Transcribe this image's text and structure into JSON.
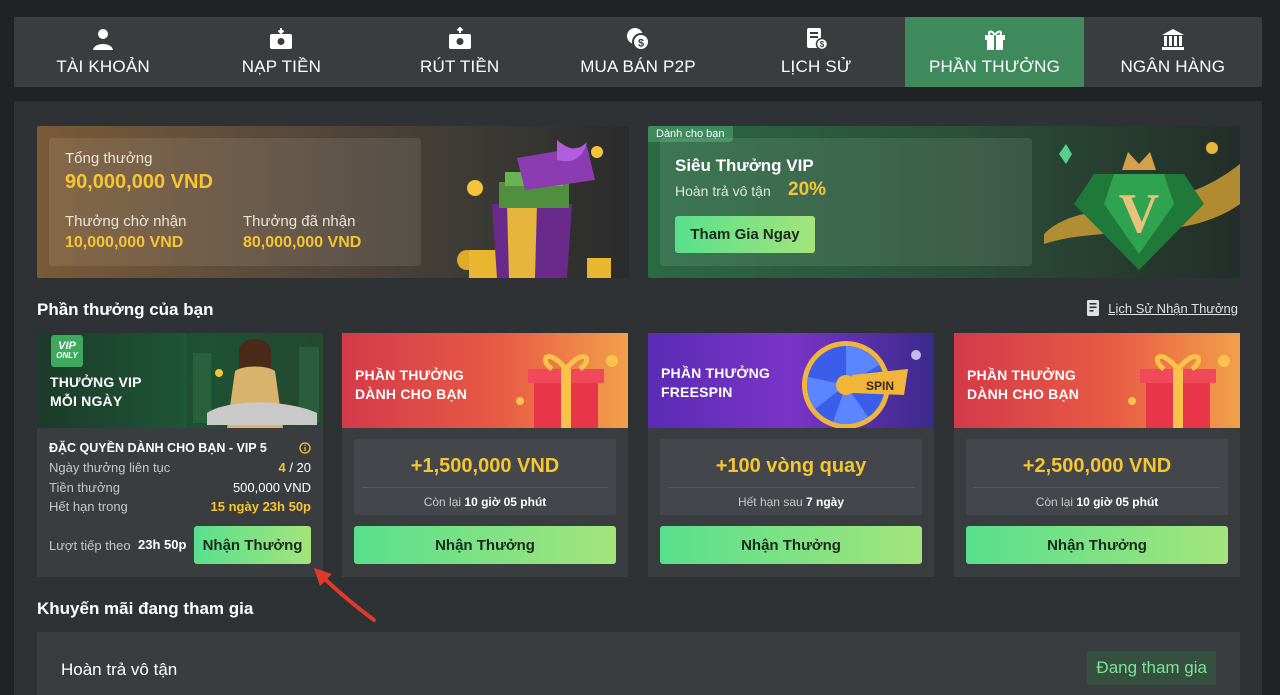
{
  "nav": [
    {
      "label": "TÀI KHOẢN",
      "icon": "user-icon",
      "active": false
    },
    {
      "label": "NẠP TIỀN",
      "icon": "deposit-icon",
      "active": false
    },
    {
      "label": "RÚT TIỀN",
      "icon": "withdraw-icon",
      "active": false
    },
    {
      "label": "MUA BÁN P2P",
      "icon": "coins-exchange-icon",
      "active": false
    },
    {
      "label": "LỊCH SỬ",
      "icon": "history-icon",
      "active": false
    },
    {
      "label": "PHẦN THƯỞNG",
      "icon": "gift-icon",
      "active": true
    },
    {
      "label": "NGÂN HÀNG",
      "icon": "bank-icon",
      "active": false
    }
  ],
  "summary": {
    "total_label": "Tổng thưởng",
    "total_value": "90,000,000 VND",
    "pending_label": "Thưởng chờ nhận",
    "pending_value": "10,000,000 VND",
    "received_label": "Thưởng đã nhận",
    "received_value": "80,000,000 VND"
  },
  "vip_banner": {
    "chip": "Dành cho bạn",
    "title": "Siêu Thưởng VIP",
    "cashback_label": "Hoàn trả vô tận",
    "cashback_value": "20%",
    "button": "Tham Gia Ngay"
  },
  "rewards_section": {
    "title": "Phần thưởng của bạn",
    "history_link": "Lịch Sử Nhận Thưởng"
  },
  "vip_card": {
    "badge_top": "VIP",
    "badge_bottom": "ONLY",
    "title_line1": "THƯỞNG VIP",
    "title_line2": "MỖI NGÀY",
    "privilege": "ĐẶC QUYỀN DÀNH CHO BẠN - VIP 5",
    "streak_label": "Ngày thưởng liên tục",
    "streak_current": "4",
    "streak_total": "/ 20",
    "bonus_label": "Tiền thưởng",
    "bonus_value": "500,000 VND",
    "expire_label": "Hết hạn trong",
    "expire_value": "15 ngày 23h 50p",
    "next_label": "Lượt tiếp theo",
    "next_value": "23h 50p",
    "button": "Nhận Thưởng"
  },
  "cards": [
    {
      "line1": "PHẦN THƯỞNG",
      "line2": "DÀNH CHO BẠN",
      "amount": "+1,500,000 VND",
      "sub_label": "Còn lại",
      "sub_value": "10 giờ 05 phút",
      "button": "Nhận Thưởng",
      "theme": "gift"
    },
    {
      "line1": "PHẦN THƯỞNG",
      "line2": "FREESPIN",
      "amount": "+100 vòng quay",
      "sub_label": "Hết hạn sau",
      "sub_value": "7 ngày",
      "button": "Nhận Thưởng",
      "theme": "spin",
      "wheel_label": "SPIN"
    },
    {
      "line1": "PHẦN THƯỞNG",
      "line2": "DÀNH CHO BẠN",
      "amount": "+2,500,000 VND",
      "sub_label": "Còn lại",
      "sub_value": "10 giờ 05 phút",
      "button": "Nhận Thưởng",
      "theme": "gift"
    }
  ],
  "promo_section": {
    "title": "Khuyến mãi đang tham gia",
    "items": [
      {
        "name": "Hoàn trả vô tận",
        "status": "Đang tham gia"
      }
    ]
  },
  "colors": {
    "accent_green": "#3e8a5c",
    "gold": "#f6c532",
    "annotation_arrow": "#e03a2a"
  }
}
